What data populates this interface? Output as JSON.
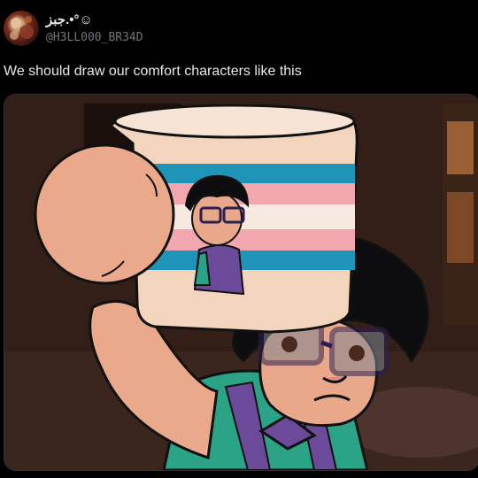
{
  "tweet": {
    "display_name": "جبز.•°☺",
    "handle": "@H3LL000_BR34D",
    "text": "We should draw our comfort characters like this"
  },
  "media": {
    "icon": "image-icon",
    "alt": ""
  },
  "colors": {
    "background": "#000000",
    "text_primary": "#e7e9ea",
    "text_secondary": "#71767b",
    "flag_blue": "#1e95b8",
    "flag_pink": "#f2a6ae",
    "mug_body": "#f3d4bd"
  }
}
